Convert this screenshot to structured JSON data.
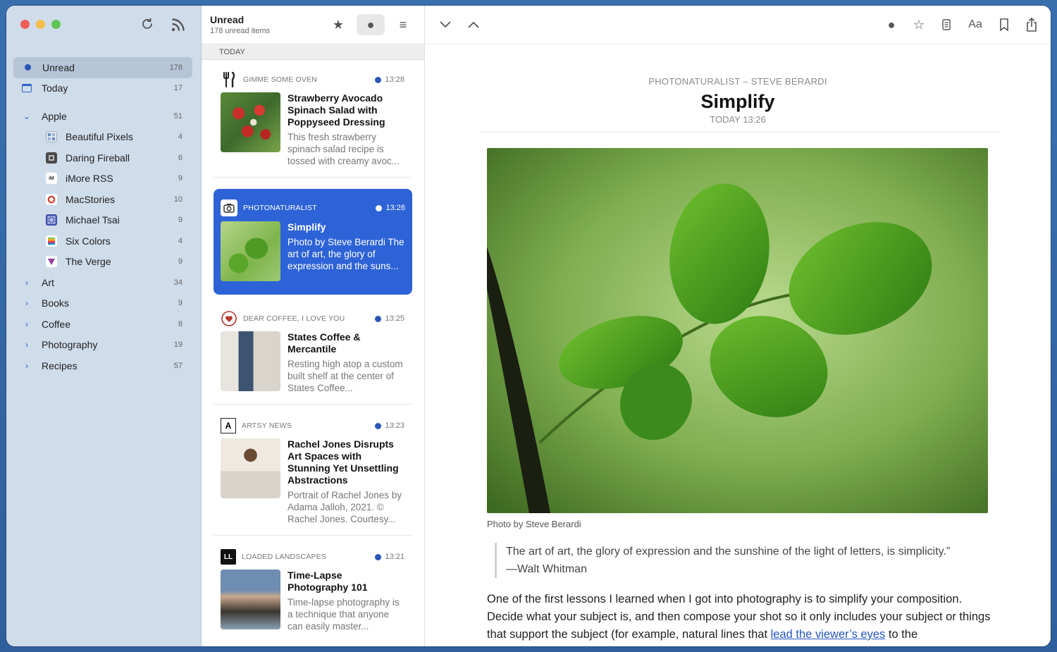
{
  "sidebar": {
    "items": [
      {
        "label": "Unread",
        "count": "178"
      },
      {
        "label": "Today",
        "count": "17"
      },
      {
        "label": "Apple",
        "count": "51"
      },
      {
        "label": "Beautiful Pixels",
        "count": "4"
      },
      {
        "label": "Daring Fireball",
        "count": "6"
      },
      {
        "label": "iMore RSS",
        "count": "9"
      },
      {
        "label": "MacStories",
        "count": "10"
      },
      {
        "label": "Michael Tsai",
        "count": "9"
      },
      {
        "label": "Six Colors",
        "count": "4"
      },
      {
        "label": "The Verge",
        "count": "9"
      },
      {
        "label": "Art",
        "count": "34"
      },
      {
        "label": "Books",
        "count": "9"
      },
      {
        "label": "Coffee",
        "count": "8"
      },
      {
        "label": "Photography",
        "count": "19"
      },
      {
        "label": "Recipes",
        "count": "57"
      }
    ],
    "favicon_text": {
      "imore": "iM",
      "michael": "M",
      "daring": "D",
      "macstories": "O",
      "verge": "V",
      "sixcolors": "6"
    }
  },
  "list": {
    "title": "Unread",
    "subtitle": "178 unread items",
    "section": "TODAY",
    "articles": [
      {
        "source": "GIMME SOME OVEN",
        "time": "13:28",
        "title": "Strawberry Avocado Spinach Salad with Poppyseed Dressing",
        "summary": "This fresh strawberry spinach salad recipe is tossed with creamy avoc..."
      },
      {
        "source": "PHOTONATURALIST",
        "time": "13:26",
        "title": "Simplify",
        "summary": "Photo by Steve Berardi The art of art, the glory of expression and the suns..."
      },
      {
        "source": "DEAR COFFEE, I LOVE YOU",
        "time": "13:25",
        "title": "States Coffee & Mercantile",
        "summary": "Resting high atop a custom built shelf at the center of States Coffee..."
      },
      {
        "source": "ARTSY NEWS",
        "time": "13:23",
        "title": "Rachel Jones Disrupts Art Spaces with Stunning Yet Unsettling Abstractions",
        "summary": "Portrait of Rachel Jones by Adama Jalloh, 2021. © Rachel Jones. Courtesy..."
      },
      {
        "source": "LOADED LANDSCAPES",
        "time": "13:21",
        "title": "Time-Lapse Photography 101",
        "summary": "Time-lapse photography is a technique that anyone can easily master..."
      }
    ],
    "source_icons": {
      "artsy": "A",
      "loaded": "LL"
    }
  },
  "reader": {
    "toolbar": {
      "font_label": "Aa"
    },
    "meta": "PHOTONATURALIST – STEVE BERARDI",
    "title": "Simplify",
    "date": "TODAY 13:26",
    "caption": "Photo by Steve Berardi",
    "quote_line1": "The art of art, the glory of expression and the sunshine of the light of letters, is simplicity.”",
    "quote_line2": "—Walt Whitman",
    "para_before": "One of the first lessons I learned when I got into photography is to simplify your composition. Decide what your subject is, and then compose your shot so it only includes your subject or things that support the subject (for example, natural lines that ",
    "para_link": "lead the viewer’s eyes",
    "para_after": " to the"
  },
  "icons": {
    "refresh": "refresh-icon",
    "subscribe": "rss-icon",
    "star": "star-icon",
    "unread": "unread-dot-icon",
    "all": "list-lines-icon",
    "next": "chevron-down-icon",
    "prev": "chevron-up-icon",
    "mark": "circle-icon",
    "bookmark": "bookmark-icon",
    "share": "share-icon",
    "reader_view": "reader-view-icon"
  },
  "colors": {
    "accent": "#2d63d6",
    "unread_dot": "#2a55b8",
    "sidebar": "#cfdcea"
  }
}
